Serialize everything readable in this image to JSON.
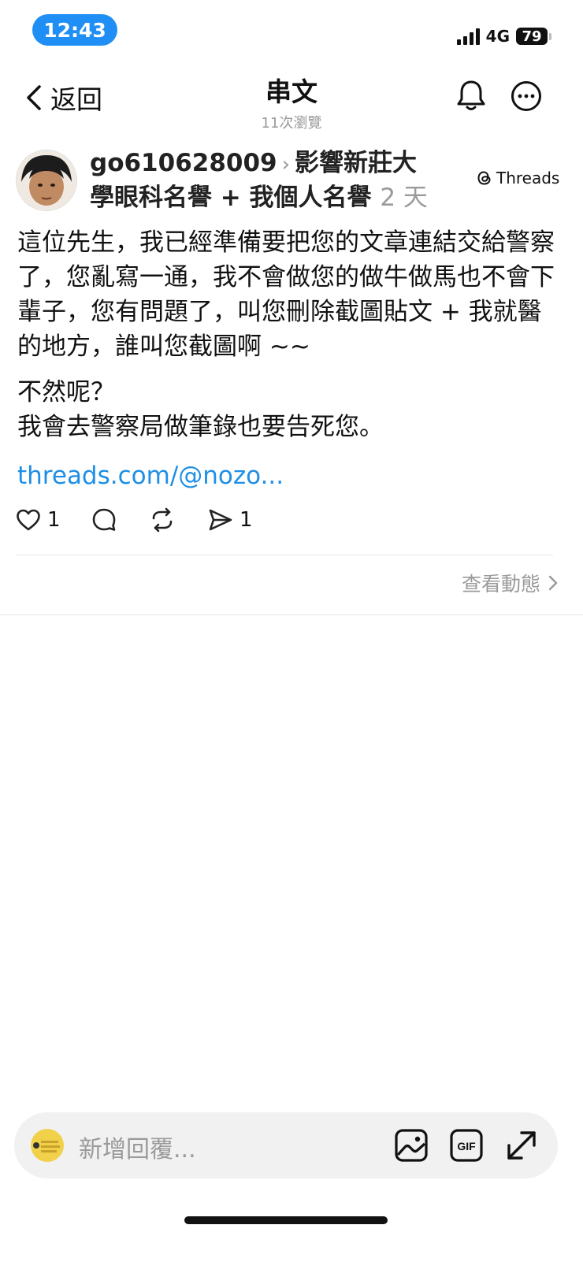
{
  "status_bar": {
    "time": "12:43",
    "network": "4G",
    "battery": "79"
  },
  "nav": {
    "back_label": "返回",
    "title": "串文",
    "subtitle": "11次瀏覽"
  },
  "post": {
    "username": "go610628009",
    "topic_line1": "影響新莊大",
    "topic_line2": "學眼科名譽 + 我個人名譽",
    "age": "2 天",
    "badge": "Threads",
    "paragraph1": "這位先生，我已經準備要把您的文章連結交給警察了，您亂寫一通，我不會做您的做牛做馬也不會下輩子，您有問題了，叫您刪除截圖貼文 + 我就醫的地方，誰叫您截圖啊 ~~",
    "paragraph2_line1": "不然呢？",
    "paragraph2_line2": "我會去警察局做筆錄也要告死您。",
    "link": "threads.com/@nozo...",
    "actions": {
      "like_count": "1",
      "share_count": "1"
    },
    "view_activity": "查看動態"
  },
  "reply": {
    "placeholder": "新增回覆..."
  },
  "icons": {
    "back": "chevron-left-icon",
    "bell": "bell-icon",
    "more": "more-icon",
    "like": "heart-icon",
    "comment": "comment-icon",
    "repost": "repost-icon",
    "share": "send-icon",
    "image": "image-icon",
    "gif": "gif-icon",
    "expand": "expand-icon"
  },
  "colors": {
    "accent_blue": "#1e8fe6",
    "status_pill": "#1f8ff5",
    "muted": "#9a9a9a"
  }
}
